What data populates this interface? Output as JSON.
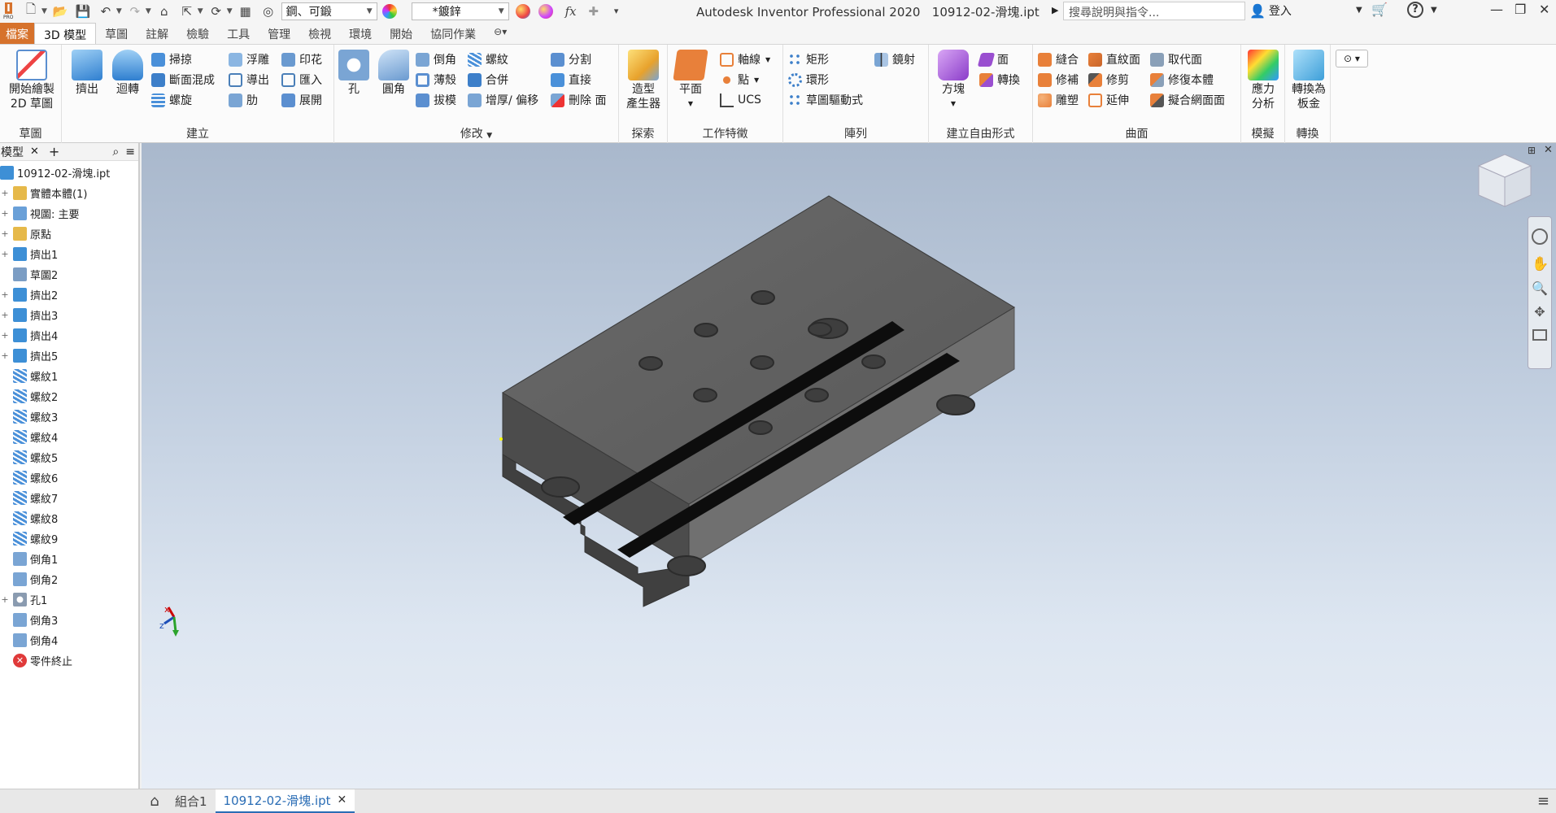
{
  "app": {
    "title": "Autodesk Inventor Professional 2020",
    "file": "10912-02-滑塊.ipt",
    "pro": "PRO"
  },
  "toolbar": {
    "material": "鋼、可鍛",
    "appearance": "*鍍鋅"
  },
  "search": {
    "placeholder": "搜尋說明與指令..."
  },
  "account": {
    "login": "登入"
  },
  "tabs": [
    {
      "label": "檔案"
    },
    {
      "label": "3D 模型"
    },
    {
      "label": "草圖"
    },
    {
      "label": "註解"
    },
    {
      "label": "檢驗"
    },
    {
      "label": "工具"
    },
    {
      "label": "管理"
    },
    {
      "label": "檢視"
    },
    {
      "label": "環境"
    },
    {
      "label": "開始"
    },
    {
      "label": "協同作業"
    }
  ],
  "ribbon": {
    "sketch": {
      "title": "草圖",
      "start_sketch": "開始繪製",
      "sketch_2d": "2D 草圖"
    },
    "create": {
      "title": "建立",
      "extrude": "擠出",
      "revolve": "迴轉",
      "sweep": "掃掠",
      "loft": "斷面混成",
      "coil": "螺旋",
      "emboss": "浮雕",
      "derive": "導出",
      "rib": "肋",
      "decal": "印花",
      "import": "匯入",
      "unfold": "展開"
    },
    "modify": {
      "title": "修改",
      "hole": "孔",
      "fillet": "圓角",
      "chamfer": "倒角",
      "shell": "薄殼",
      "draft": "拔模",
      "thread": "螺紋",
      "combine": "合併",
      "thicken": "增厚/ 偏移",
      "split": "分割",
      "direct": "直接",
      "delete_face": "刪除 面"
    },
    "explore": {
      "title": "探索",
      "shape_generator_1": "造型",
      "shape_generator_2": "產生器"
    },
    "work_features": {
      "title": "工作特徵",
      "plane": "平面",
      "axis": "軸線",
      "point": "點",
      "ucs": "UCS"
    },
    "pattern": {
      "title": "陣列",
      "rectangular": "矩形",
      "circular": "環形",
      "sketch_driven": "草圖驅動式",
      "mirror": "鏡射"
    },
    "freeform": {
      "title": "建立自由形式",
      "box": "方塊",
      "face": "面",
      "convert": "轉換"
    },
    "surface": {
      "title": "曲面",
      "stitch": "縫合",
      "patch": "修補",
      "sculpt": "雕塑",
      "ruled": "直紋面",
      "trim": "修剪",
      "extend": "延伸",
      "replace_face": "取代面",
      "repair_bodies": "修復本體",
      "fit_mesh": "擬合網面面"
    },
    "simulation": {
      "title": "模擬",
      "stress_1": "應力",
      "stress_2": "分析"
    },
    "convert": {
      "title": "轉換",
      "sheet_metal_1": "轉換為",
      "sheet_metal_2": "板金"
    }
  },
  "browser": {
    "header": "模型",
    "items": [
      {
        "label": "10912-02-滑塊.ipt",
        "icon": "part-icon",
        "color": "#3d8fd6"
      },
      {
        "label": "實體本體(1)",
        "icon": "folder-icon",
        "color": "#e6b94a"
      },
      {
        "label": "視圖: 主要",
        "icon": "view-icon",
        "color": "#6aa0d8"
      },
      {
        "label": "原點",
        "icon": "folder-icon",
        "color": "#e6b94a"
      },
      {
        "label": "擠出1",
        "icon": "extrude-icon",
        "color": "#3d8fd6"
      },
      {
        "label": "草圖2",
        "icon": "sketch-icon",
        "color": "#7b9dc4"
      },
      {
        "label": "擠出2",
        "icon": "extrude-icon",
        "color": "#3d8fd6"
      },
      {
        "label": "擠出3",
        "icon": "extrude-icon",
        "color": "#3d8fd6"
      },
      {
        "label": "擠出4",
        "icon": "extrude-icon",
        "color": "#3d8fd6"
      },
      {
        "label": "擠出5",
        "icon": "extrude-icon",
        "color": "#3d8fd6"
      },
      {
        "label": "螺紋1",
        "icon": "thread-icon",
        "color": "#4a90d9"
      },
      {
        "label": "螺紋2",
        "icon": "thread-icon",
        "color": "#4a90d9"
      },
      {
        "label": "螺紋3",
        "icon": "thread-icon",
        "color": "#4a90d9"
      },
      {
        "label": "螺紋4",
        "icon": "thread-icon",
        "color": "#4a90d9"
      },
      {
        "label": "螺紋5",
        "icon": "thread-icon",
        "color": "#4a90d9"
      },
      {
        "label": "螺紋6",
        "icon": "thread-icon",
        "color": "#4a90d9"
      },
      {
        "label": "螺紋7",
        "icon": "thread-icon",
        "color": "#4a90d9"
      },
      {
        "label": "螺紋8",
        "icon": "thread-icon",
        "color": "#4a90d9"
      },
      {
        "label": "螺紋9",
        "icon": "thread-icon",
        "color": "#4a90d9"
      },
      {
        "label": "倒角1",
        "icon": "chamfer-icon",
        "color": "#7aa5d4"
      },
      {
        "label": "倒角2",
        "icon": "chamfer-icon",
        "color": "#7aa5d4"
      },
      {
        "label": "孔1",
        "icon": "hole-icon",
        "color": "#8a9bb0"
      },
      {
        "label": "倒角3",
        "icon": "chamfer-icon",
        "color": "#7aa5d4"
      },
      {
        "label": "倒角4",
        "icon": "chamfer-icon",
        "color": "#7aa5d4"
      },
      {
        "label": "零件終止",
        "icon": "end-of-part-icon",
        "color": "#e03a3a"
      }
    ]
  },
  "doc_tabs": [
    {
      "label": "組合1"
    },
    {
      "label": "10912-02-滑塊.ipt"
    }
  ],
  "axes": {
    "x": "x",
    "z": "z"
  },
  "colors": {
    "accent": "#d6722c",
    "model": "#5a5a5a",
    "slot": "#111111",
    "link": "#2a6db5"
  }
}
